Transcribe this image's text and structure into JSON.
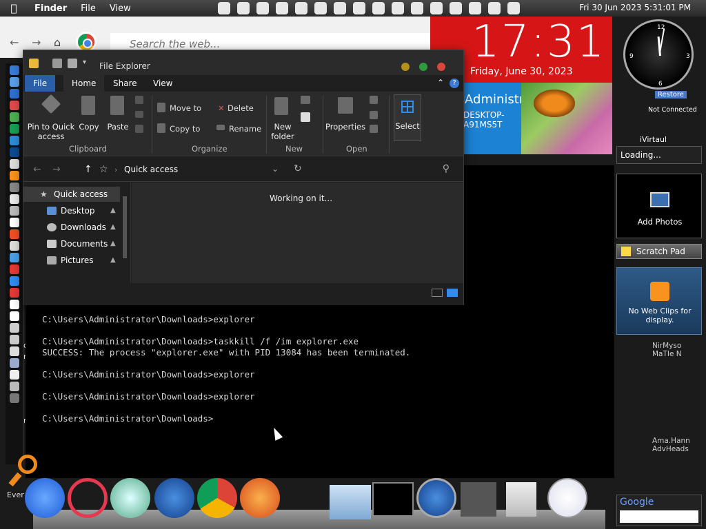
{
  "menubar": {
    "app_name": "Finder",
    "menus": [
      "File",
      "View"
    ],
    "clock": "Fri 30 Jun 2023  5:31:01 PM"
  },
  "browser": {
    "search_placeholder": "Search the web..."
  },
  "explorer": {
    "title": "File Explorer",
    "tabs": [
      "File",
      "Home",
      "Share",
      "View"
    ],
    "ribbon": {
      "pin_label": "Pin to Quick access",
      "copy": "Copy",
      "paste": "Paste",
      "move_to": "Move to",
      "copy_to": "Copy to",
      "delete": "Delete",
      "rename": "Rename",
      "new_folder": "New folder",
      "properties": "Properties",
      "select": "Select",
      "groups": [
        "Clipboard",
        "Organize",
        "New",
        "Open"
      ]
    },
    "address_path": "Quick access",
    "nav": [
      {
        "label": "Quick access",
        "selected": true
      },
      {
        "label": "Desktop"
      },
      {
        "label": "Downloads"
      },
      {
        "label": "Documents"
      },
      {
        "label": "Pictures"
      }
    ],
    "status_message": "Working on it..."
  },
  "terminal": {
    "lines": [
      "C:\\Users\\Administrator\\Downloads>explorer",
      "",
      "C:\\Users\\Administrator\\Downloads>taskkill /f /im explorer.exe",
      "SUCCESS: The process \"explorer.exe\" with PID 13084 has been terminated.",
      "",
      "C:\\Users\\Administrator\\Downloads>explorer",
      "",
      "C:\\Users\\Administrator\\Downloads>explorer",
      "",
      "C:\\Users\\Administrator\\Downloads>"
    ]
  },
  "clock_tile": {
    "time": "17:31",
    "date": "Friday, June 30, 2023"
  },
  "user_tile": {
    "name": "Administrator",
    "computer": "DESKTOP-A91MS5T"
  },
  "gadgets": {
    "restore": "Restore",
    "not_connected": "Not Connected",
    "ivirtaul": "iVirtaul",
    "loading": "Loading...",
    "add_photos": "Add Photos",
    "scratch_pad": "Scratch Pad",
    "web_clips": "No Web Clips for display.",
    "google": "Google"
  },
  "right_stubs": [
    "NirMyso MaTIe N",
    "Ama.Hann AdvHeads"
  ],
  "left_stubs": [
    "oSys",
    "ntact",
    "nsho",
    "Ever"
  ],
  "colors": {
    "clock_red": "#d61616",
    "user_blue": "#1b82d4",
    "file_tab": "#2a5fa8"
  }
}
